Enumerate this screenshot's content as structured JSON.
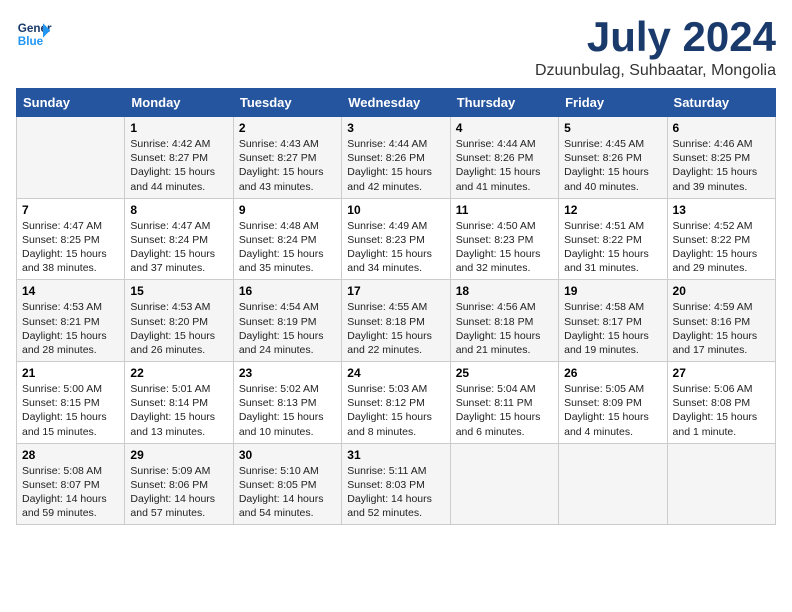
{
  "header": {
    "logo_line1": "General",
    "logo_line2": "Blue",
    "month": "July 2024",
    "location": "Dzuunbulag, Suhbaatar, Mongolia"
  },
  "weekdays": [
    "Sunday",
    "Monday",
    "Tuesday",
    "Wednesday",
    "Thursday",
    "Friday",
    "Saturday"
  ],
  "weeks": [
    [
      {
        "day": "",
        "sunrise": "",
        "sunset": "",
        "daylight": ""
      },
      {
        "day": "1",
        "sunrise": "Sunrise: 4:42 AM",
        "sunset": "Sunset: 8:27 PM",
        "daylight": "Daylight: 15 hours and 44 minutes."
      },
      {
        "day": "2",
        "sunrise": "Sunrise: 4:43 AM",
        "sunset": "Sunset: 8:27 PM",
        "daylight": "Daylight: 15 hours and 43 minutes."
      },
      {
        "day": "3",
        "sunrise": "Sunrise: 4:44 AM",
        "sunset": "Sunset: 8:26 PM",
        "daylight": "Daylight: 15 hours and 42 minutes."
      },
      {
        "day": "4",
        "sunrise": "Sunrise: 4:44 AM",
        "sunset": "Sunset: 8:26 PM",
        "daylight": "Daylight: 15 hours and 41 minutes."
      },
      {
        "day": "5",
        "sunrise": "Sunrise: 4:45 AM",
        "sunset": "Sunset: 8:26 PM",
        "daylight": "Daylight: 15 hours and 40 minutes."
      },
      {
        "day": "6",
        "sunrise": "Sunrise: 4:46 AM",
        "sunset": "Sunset: 8:25 PM",
        "daylight": "Daylight: 15 hours and 39 minutes."
      }
    ],
    [
      {
        "day": "7",
        "sunrise": "Sunrise: 4:47 AM",
        "sunset": "Sunset: 8:25 PM",
        "daylight": "Daylight: 15 hours and 38 minutes."
      },
      {
        "day": "8",
        "sunrise": "Sunrise: 4:47 AM",
        "sunset": "Sunset: 8:24 PM",
        "daylight": "Daylight: 15 hours and 37 minutes."
      },
      {
        "day": "9",
        "sunrise": "Sunrise: 4:48 AM",
        "sunset": "Sunset: 8:24 PM",
        "daylight": "Daylight: 15 hours and 35 minutes."
      },
      {
        "day": "10",
        "sunrise": "Sunrise: 4:49 AM",
        "sunset": "Sunset: 8:23 PM",
        "daylight": "Daylight: 15 hours and 34 minutes."
      },
      {
        "day": "11",
        "sunrise": "Sunrise: 4:50 AM",
        "sunset": "Sunset: 8:23 PM",
        "daylight": "Daylight: 15 hours and 32 minutes."
      },
      {
        "day": "12",
        "sunrise": "Sunrise: 4:51 AM",
        "sunset": "Sunset: 8:22 PM",
        "daylight": "Daylight: 15 hours and 31 minutes."
      },
      {
        "day": "13",
        "sunrise": "Sunrise: 4:52 AM",
        "sunset": "Sunset: 8:22 PM",
        "daylight": "Daylight: 15 hours and 29 minutes."
      }
    ],
    [
      {
        "day": "14",
        "sunrise": "Sunrise: 4:53 AM",
        "sunset": "Sunset: 8:21 PM",
        "daylight": "Daylight: 15 hours and 28 minutes."
      },
      {
        "day": "15",
        "sunrise": "Sunrise: 4:53 AM",
        "sunset": "Sunset: 8:20 PM",
        "daylight": "Daylight: 15 hours and 26 minutes."
      },
      {
        "day": "16",
        "sunrise": "Sunrise: 4:54 AM",
        "sunset": "Sunset: 8:19 PM",
        "daylight": "Daylight: 15 hours and 24 minutes."
      },
      {
        "day": "17",
        "sunrise": "Sunrise: 4:55 AM",
        "sunset": "Sunset: 8:18 PM",
        "daylight": "Daylight: 15 hours and 22 minutes."
      },
      {
        "day": "18",
        "sunrise": "Sunrise: 4:56 AM",
        "sunset": "Sunset: 8:18 PM",
        "daylight": "Daylight: 15 hours and 21 minutes."
      },
      {
        "day": "19",
        "sunrise": "Sunrise: 4:58 AM",
        "sunset": "Sunset: 8:17 PM",
        "daylight": "Daylight: 15 hours and 19 minutes."
      },
      {
        "day": "20",
        "sunrise": "Sunrise: 4:59 AM",
        "sunset": "Sunset: 8:16 PM",
        "daylight": "Daylight: 15 hours and 17 minutes."
      }
    ],
    [
      {
        "day": "21",
        "sunrise": "Sunrise: 5:00 AM",
        "sunset": "Sunset: 8:15 PM",
        "daylight": "Daylight: 15 hours and 15 minutes."
      },
      {
        "day": "22",
        "sunrise": "Sunrise: 5:01 AM",
        "sunset": "Sunset: 8:14 PM",
        "daylight": "Daylight: 15 hours and 13 minutes."
      },
      {
        "day": "23",
        "sunrise": "Sunrise: 5:02 AM",
        "sunset": "Sunset: 8:13 PM",
        "daylight": "Daylight: 15 hours and 10 minutes."
      },
      {
        "day": "24",
        "sunrise": "Sunrise: 5:03 AM",
        "sunset": "Sunset: 8:12 PM",
        "daylight": "Daylight: 15 hours and 8 minutes."
      },
      {
        "day": "25",
        "sunrise": "Sunrise: 5:04 AM",
        "sunset": "Sunset: 8:11 PM",
        "daylight": "Daylight: 15 hours and 6 minutes."
      },
      {
        "day": "26",
        "sunrise": "Sunrise: 5:05 AM",
        "sunset": "Sunset: 8:09 PM",
        "daylight": "Daylight: 15 hours and 4 minutes."
      },
      {
        "day": "27",
        "sunrise": "Sunrise: 5:06 AM",
        "sunset": "Sunset: 8:08 PM",
        "daylight": "Daylight: 15 hours and 1 minute."
      }
    ],
    [
      {
        "day": "28",
        "sunrise": "Sunrise: 5:08 AM",
        "sunset": "Sunset: 8:07 PM",
        "daylight": "Daylight: 14 hours and 59 minutes."
      },
      {
        "day": "29",
        "sunrise": "Sunrise: 5:09 AM",
        "sunset": "Sunset: 8:06 PM",
        "daylight": "Daylight: 14 hours and 57 minutes."
      },
      {
        "day": "30",
        "sunrise": "Sunrise: 5:10 AM",
        "sunset": "Sunset: 8:05 PM",
        "daylight": "Daylight: 14 hours and 54 minutes."
      },
      {
        "day": "31",
        "sunrise": "Sunrise: 5:11 AM",
        "sunset": "Sunset: 8:03 PM",
        "daylight": "Daylight: 14 hours and 52 minutes."
      },
      {
        "day": "",
        "sunrise": "",
        "sunset": "",
        "daylight": ""
      },
      {
        "day": "",
        "sunrise": "",
        "sunset": "",
        "daylight": ""
      },
      {
        "day": "",
        "sunrise": "",
        "sunset": "",
        "daylight": ""
      }
    ]
  ]
}
